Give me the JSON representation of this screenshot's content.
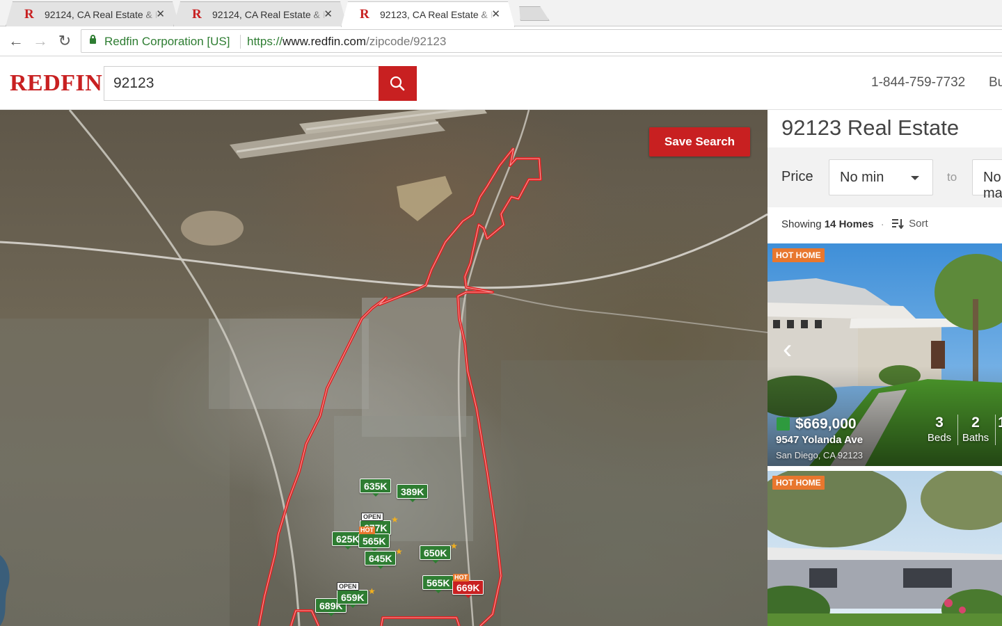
{
  "browser": {
    "tabs": [
      {
        "title": "92124, CA Real Estate & Homes for Sale",
        "favicon": "R",
        "active": false
      },
      {
        "title": "92124, CA Real Estate & Homes for Sale",
        "favicon": "R",
        "active": false
      },
      {
        "title": "92123, CA Real Estate & Homes for Sale",
        "favicon": "R",
        "active": true
      }
    ],
    "close_glyph": "✕",
    "nav": {
      "back": "←",
      "forward": "→",
      "reload": "↻"
    },
    "security_label": "Redfin Corporation [US]",
    "url": {
      "scheme": "https://",
      "host": "www.redfin.com",
      "path": "/zipcode/92123"
    }
  },
  "site": {
    "logo": "REDFIN",
    "search_value": "92123",
    "phone": "1-844-759-7732",
    "nav_partial": "Bu"
  },
  "map": {
    "save_search_label": "Save Search",
    "pins": [
      {
        "label": "635K",
        "color": "green"
      },
      {
        "label": "389K",
        "color": "green"
      },
      {
        "label": "677K",
        "color": "green"
      },
      {
        "label": "625K",
        "color": "green"
      },
      {
        "label": "565K",
        "color": "green"
      },
      {
        "label": "645K",
        "color": "green"
      },
      {
        "label": "650K",
        "color": "green"
      },
      {
        "label": "565K",
        "color": "green"
      },
      {
        "label": "669K",
        "color": "red"
      },
      {
        "label": "659K",
        "color": "green"
      },
      {
        "label": "689K",
        "color": "green"
      }
    ],
    "badges": {
      "hot": "HOT",
      "open": "OPEN",
      "star": "★"
    },
    "colors": {
      "pin_green": "#2e7d32",
      "pin_red": "#c82021",
      "boundary": "#e02020",
      "hot": "#e8772e"
    }
  },
  "panel": {
    "title": "92123 Real Estate",
    "price_label": "Price",
    "price_min": "No min",
    "to_label": "to",
    "price_max": "No max",
    "results_prefix": "Showing",
    "results_count": "14 Homes",
    "sort_label": "Sort",
    "listings": [
      {
        "tag": "HOT HOME",
        "price": "$669,000",
        "street": "9547 Yolanda Ave",
        "city": "San Diego, CA 92123",
        "beds": "3",
        "beds_label": "Beds",
        "baths": "2",
        "baths_label": "Baths",
        "sqft_partial": "1"
      },
      {
        "tag": "HOT HOME"
      }
    ]
  },
  "theme": {
    "brand_red": "#c82021"
  }
}
